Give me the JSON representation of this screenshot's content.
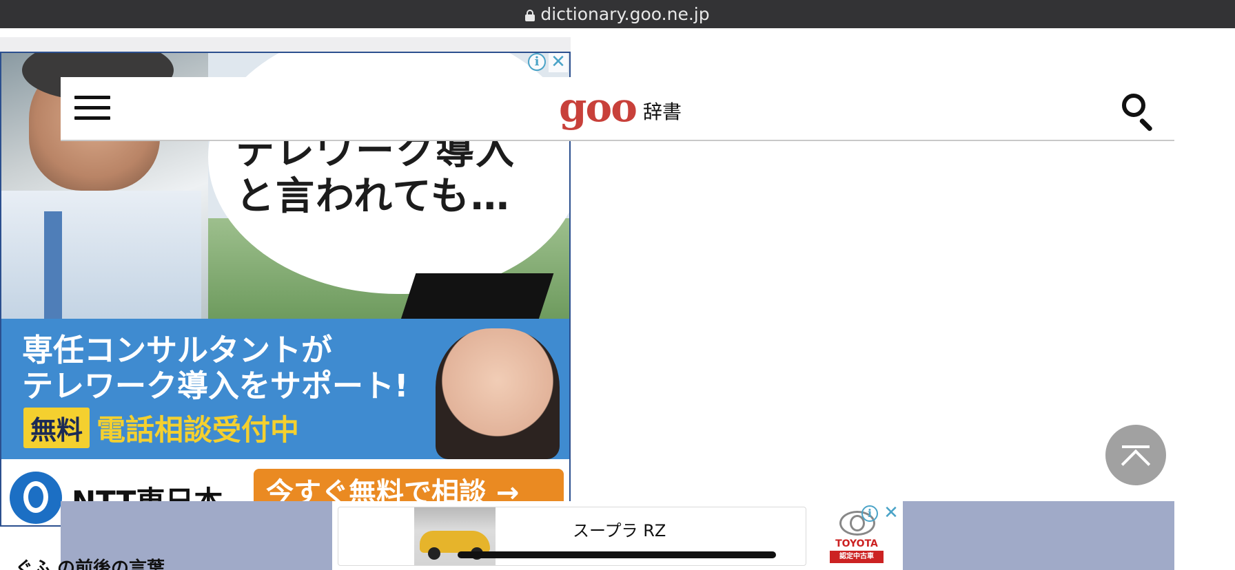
{
  "browser": {
    "url": "dictionary.goo.ne.jp",
    "lock_icon": "lock-icon"
  },
  "header": {
    "menu_icon": "hamburger-menu-icon",
    "logo_text": "goo",
    "logo_suffix": "辞書",
    "search_icon": "search-icon",
    "logo_color": "#c8403a"
  },
  "top_ad": {
    "headline_line1": "テレワーク導入",
    "headline_line2": "と言われても…",
    "body_line1": "専任コンサルタントが",
    "body_line2": "テレワーク導入をサポート!",
    "free_badge": "無料",
    "phone_text": "電話相談受付中",
    "brand": "NTT東日本",
    "cta": "今すぐ無料で相談 →",
    "info_icon": "info-icon",
    "close_icon": "close-icon",
    "accent_color": "#3f8bd0"
  },
  "scroll_top": {
    "icon": "scroll-to-top-icon"
  },
  "content": {
    "section_heading": "ぐふ の前後の言葉"
  },
  "bottom_ad": {
    "title": "スープラ RZ",
    "brand_name": "TOYOTA",
    "brand_sub": "認定中古車",
    "info_icon": "info-icon",
    "close_icon": "close-icon"
  }
}
